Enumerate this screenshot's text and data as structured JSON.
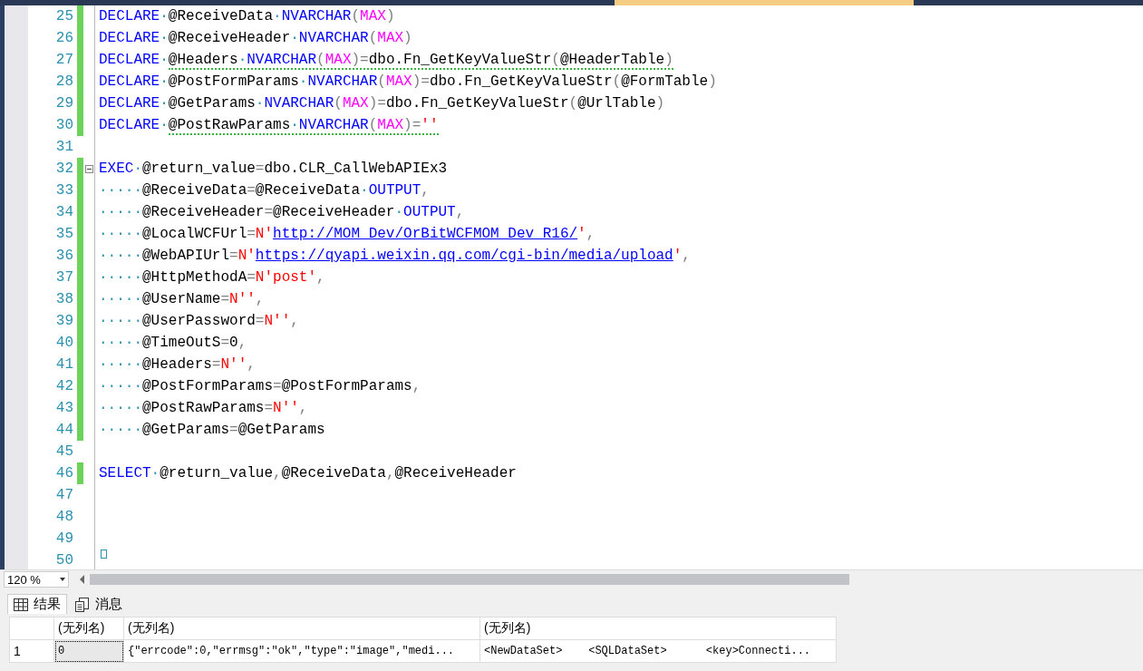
{
  "editor": {
    "lines": [
      {
        "number": "25",
        "changed": true,
        "collapsible": false,
        "segments": [
          {
            "squiggle": false,
            "tokens": [
              {
                "kind": "keyword",
                "text": "DECLARE"
              },
              {
                "kind": "ws",
                "text": "·"
              },
              {
                "kind": "plain",
                "text": "@ReceiveData"
              },
              {
                "kind": "ws",
                "text": "·"
              },
              {
                "kind": "keyword",
                "text": "NVARCHAR"
              },
              {
                "kind": "punct",
                "text": "("
              },
              {
                "kind": "function",
                "text": "MAX"
              },
              {
                "kind": "punct",
                "text": ")"
              }
            ]
          }
        ]
      },
      {
        "number": "26",
        "changed": true,
        "collapsible": false,
        "segments": [
          {
            "squiggle": false,
            "tokens": [
              {
                "kind": "keyword",
                "text": "DECLARE"
              },
              {
                "kind": "ws",
                "text": "·"
              },
              {
                "kind": "plain",
                "text": "@ReceiveHeader"
              },
              {
                "kind": "ws",
                "text": "·"
              },
              {
                "kind": "keyword",
                "text": "NVARCHAR"
              },
              {
                "kind": "punct",
                "text": "("
              },
              {
                "kind": "function",
                "text": "MAX"
              },
              {
                "kind": "punct",
                "text": ")"
              }
            ]
          }
        ]
      },
      {
        "number": "27",
        "changed": true,
        "collapsible": false,
        "segments": [
          {
            "squiggle": false,
            "tokens": [
              {
                "kind": "keyword",
                "text": "DECLARE"
              },
              {
                "kind": "ws",
                "text": "·"
              }
            ]
          },
          {
            "squiggle": true,
            "tokens": [
              {
                "kind": "plain",
                "text": "@Headers"
              },
              {
                "kind": "ws",
                "text": "·"
              },
              {
                "kind": "keyword",
                "text": "NVARCHAR"
              },
              {
                "kind": "punct",
                "text": "("
              },
              {
                "kind": "function",
                "text": "MAX"
              },
              {
                "kind": "punct",
                "text": ")="
              },
              {
                "kind": "plain",
                "text": "dbo.Fn_GetKeyValueStr"
              },
              {
                "kind": "punct",
                "text": "("
              },
              {
                "kind": "plain",
                "text": "@HeaderTable"
              },
              {
                "kind": "punct",
                "text": ")"
              }
            ]
          }
        ]
      },
      {
        "number": "28",
        "changed": true,
        "collapsible": false,
        "segments": [
          {
            "squiggle": false,
            "tokens": [
              {
                "kind": "keyword",
                "text": "DECLARE"
              },
              {
                "kind": "ws",
                "text": "·"
              },
              {
                "kind": "plain",
                "text": "@PostFormParams"
              },
              {
                "kind": "ws",
                "text": "·"
              },
              {
                "kind": "keyword",
                "text": "NVARCHAR"
              },
              {
                "kind": "punct",
                "text": "("
              },
              {
                "kind": "function",
                "text": "MAX"
              },
              {
                "kind": "punct",
                "text": ")="
              },
              {
                "kind": "plain",
                "text": "dbo.Fn_GetKeyValueStr"
              },
              {
                "kind": "punct",
                "text": "("
              },
              {
                "kind": "plain",
                "text": "@FormTable"
              },
              {
                "kind": "punct",
                "text": ")"
              }
            ]
          }
        ]
      },
      {
        "number": "29",
        "changed": true,
        "collapsible": false,
        "segments": [
          {
            "squiggle": false,
            "tokens": [
              {
                "kind": "keyword",
                "text": "DECLARE"
              },
              {
                "kind": "ws",
                "text": "·"
              },
              {
                "kind": "plain",
                "text": "@GetParams"
              },
              {
                "kind": "ws",
                "text": "·"
              },
              {
                "kind": "keyword",
                "text": "NVARCHAR"
              },
              {
                "kind": "punct",
                "text": "("
              },
              {
                "kind": "function",
                "text": "MAX"
              },
              {
                "kind": "punct",
                "text": ")="
              },
              {
                "kind": "plain",
                "text": "dbo.Fn_GetKeyValueStr"
              },
              {
                "kind": "punct",
                "text": "("
              },
              {
                "kind": "plain",
                "text": "@UrlTable"
              },
              {
                "kind": "punct",
                "text": ")"
              }
            ]
          }
        ]
      },
      {
        "number": "30",
        "changed": true,
        "collapsible": false,
        "segments": [
          {
            "squiggle": false,
            "tokens": [
              {
                "kind": "keyword",
                "text": "DECLARE"
              },
              {
                "kind": "ws",
                "text": "·"
              }
            ]
          },
          {
            "squiggle": true,
            "tokens": [
              {
                "kind": "plain",
                "text": "@PostRawParams"
              },
              {
                "kind": "ws",
                "text": "·"
              },
              {
                "kind": "keyword",
                "text": "NVARCHAR"
              },
              {
                "kind": "punct",
                "text": "("
              },
              {
                "kind": "function",
                "text": "MAX"
              },
              {
                "kind": "punct",
                "text": ")="
              },
              {
                "kind": "string",
                "text": "''"
              }
            ]
          }
        ]
      },
      {
        "number": "31",
        "changed": false,
        "collapsible": false
      },
      {
        "number": "32",
        "changed": true,
        "collapsible": true,
        "segments": [
          {
            "squiggle": false,
            "tokens": [
              {
                "kind": "keyword",
                "text": "EXEC"
              },
              {
                "kind": "ws",
                "text": "·"
              },
              {
                "kind": "plain",
                "text": "@return_value"
              },
              {
                "kind": "punct",
                "text": "="
              },
              {
                "kind": "plain",
                "text": "dbo.CLR_CallWebAPIEx3"
              }
            ]
          }
        ]
      },
      {
        "number": "33",
        "changed": true,
        "collapsible": false,
        "segments": [
          {
            "squiggle": false,
            "tokens": [
              {
                "kind": "ws",
                "text": "·····"
              },
              {
                "kind": "plain",
                "text": "@ReceiveData"
              },
              {
                "kind": "punct",
                "text": "="
              },
              {
                "kind": "plain",
                "text": "@ReceiveData"
              },
              {
                "kind": "ws",
                "text": "·"
              },
              {
                "kind": "keyword",
                "text": "OUTPUT"
              },
              {
                "kind": "punct",
                "text": ","
              }
            ]
          }
        ]
      },
      {
        "number": "34",
        "changed": true,
        "collapsible": false,
        "segments": [
          {
            "squiggle": false,
            "tokens": [
              {
                "kind": "ws",
                "text": "·····"
              },
              {
                "kind": "plain",
                "text": "@ReceiveHeader"
              },
              {
                "kind": "punct",
                "text": "="
              },
              {
                "kind": "plain",
                "text": "@ReceiveHeader"
              },
              {
                "kind": "ws",
                "text": "·"
              },
              {
                "kind": "keyword",
                "text": "OUTPUT"
              },
              {
                "kind": "punct",
                "text": ","
              }
            ]
          }
        ]
      },
      {
        "number": "35",
        "changed": true,
        "collapsible": false,
        "segments": [
          {
            "squiggle": false,
            "tokens": [
              {
                "kind": "ws",
                "text": "·····"
              },
              {
                "kind": "plain",
                "text": "@LocalWCFUrl"
              },
              {
                "kind": "punct",
                "text": "="
              },
              {
                "kind": "string",
                "text": "N'"
              },
              {
                "kind": "link",
                "text": "http://MOM_Dev/OrBitWCFMOM_Dev_R16/"
              },
              {
                "kind": "string",
                "text": "'"
              },
              {
                "kind": "punct",
                "text": ","
              }
            ]
          }
        ]
      },
      {
        "number": "36",
        "changed": true,
        "collapsible": false,
        "segments": [
          {
            "squiggle": false,
            "tokens": [
              {
                "kind": "ws",
                "text": "·····"
              },
              {
                "kind": "plain",
                "text": "@WebAPIUrl"
              },
              {
                "kind": "punct",
                "text": "="
              },
              {
                "kind": "string",
                "text": "N'"
              },
              {
                "kind": "link",
                "text": "https://qyapi.weixin.qq.com/cgi-bin/media/upload"
              },
              {
                "kind": "string",
                "text": "'"
              },
              {
                "kind": "punct",
                "text": ","
              }
            ]
          }
        ]
      },
      {
        "number": "37",
        "changed": true,
        "collapsible": false,
        "segments": [
          {
            "squiggle": false,
            "tokens": [
              {
                "kind": "ws",
                "text": "·····"
              },
              {
                "kind": "plain",
                "text": "@HttpMethodA"
              },
              {
                "kind": "punct",
                "text": "="
              },
              {
                "kind": "string",
                "text": "N'post'"
              },
              {
                "kind": "punct",
                "text": ","
              }
            ]
          }
        ]
      },
      {
        "number": "38",
        "changed": true,
        "collapsible": false,
        "segments": [
          {
            "squiggle": false,
            "tokens": [
              {
                "kind": "ws",
                "text": "·····"
              },
              {
                "kind": "plain",
                "text": "@UserName"
              },
              {
                "kind": "punct",
                "text": "="
              },
              {
                "kind": "string",
                "text": "N''"
              },
              {
                "kind": "punct",
                "text": ","
              }
            ]
          }
        ]
      },
      {
        "number": "39",
        "changed": true,
        "collapsible": false,
        "segments": [
          {
            "squiggle": false,
            "tokens": [
              {
                "kind": "ws",
                "text": "·····"
              },
              {
                "kind": "plain",
                "text": "@UserPassword"
              },
              {
                "kind": "punct",
                "text": "="
              },
              {
                "kind": "string",
                "text": "N''"
              },
              {
                "kind": "punct",
                "text": ","
              }
            ]
          }
        ]
      },
      {
        "number": "40",
        "changed": true,
        "collapsible": false,
        "segments": [
          {
            "squiggle": false,
            "tokens": [
              {
                "kind": "ws",
                "text": "·····"
              },
              {
                "kind": "plain",
                "text": "@TimeOutS"
              },
              {
                "kind": "punct",
                "text": "="
              },
              {
                "kind": "plain",
                "text": "0"
              },
              {
                "kind": "punct",
                "text": ","
              }
            ]
          }
        ]
      },
      {
        "number": "41",
        "changed": true,
        "collapsible": false,
        "segments": [
          {
            "squiggle": false,
            "tokens": [
              {
                "kind": "ws",
                "text": "·····"
              },
              {
                "kind": "plain",
                "text": "@Headers"
              },
              {
                "kind": "punct",
                "text": "="
              },
              {
                "kind": "string",
                "text": "N''"
              },
              {
                "kind": "punct",
                "text": ","
              }
            ]
          }
        ]
      },
      {
        "number": "42",
        "changed": true,
        "collapsible": false,
        "segments": [
          {
            "squiggle": false,
            "tokens": [
              {
                "kind": "ws",
                "text": "·····"
              },
              {
                "kind": "plain",
                "text": "@PostFormParams"
              },
              {
                "kind": "punct",
                "text": "="
              },
              {
                "kind": "plain",
                "text": "@PostFormParams"
              },
              {
                "kind": "punct",
                "text": ","
              }
            ]
          }
        ]
      },
      {
        "number": "43",
        "changed": true,
        "collapsible": false,
        "segments": [
          {
            "squiggle": false,
            "tokens": [
              {
                "kind": "ws",
                "text": "·····"
              },
              {
                "kind": "plain",
                "text": "@PostRawParams"
              },
              {
                "kind": "punct",
                "text": "="
              },
              {
                "kind": "string",
                "text": "N''"
              },
              {
                "kind": "punct",
                "text": ","
              }
            ]
          }
        ]
      },
      {
        "number": "44",
        "changed": true,
        "collapsible": false,
        "segments": [
          {
            "squiggle": false,
            "tokens": [
              {
                "kind": "ws",
                "text": "·····"
              },
              {
                "kind": "plain",
                "text": "@GetParams"
              },
              {
                "kind": "punct",
                "text": "="
              },
              {
                "kind": "plain",
                "text": "@GetParams"
              }
            ]
          }
        ]
      },
      {
        "number": "45",
        "changed": false,
        "collapsible": false
      },
      {
        "number": "46",
        "changed": true,
        "collapsible": false,
        "segments": [
          {
            "squiggle": false,
            "tokens": [
              {
                "kind": "keyword",
                "text": "SELECT"
              },
              {
                "kind": "ws",
                "text": "·"
              },
              {
                "kind": "plain",
                "text": "@return_value"
              },
              {
                "kind": "punct",
                "text": ","
              },
              {
                "kind": "plain",
                "text": "@ReceiveData"
              },
              {
                "kind": "punct",
                "text": ","
              },
              {
                "kind": "plain",
                "text": "@ReceiveHeader"
              }
            ]
          }
        ]
      },
      {
        "number": "47",
        "changed": false,
        "collapsible": false
      },
      {
        "number": "48",
        "changed": false,
        "collapsible": false
      },
      {
        "number": "49",
        "changed": false,
        "collapsible": false
      },
      {
        "number": "50",
        "changed": false,
        "collapsible": false
      }
    ]
  },
  "zoom": {
    "value": "120 %"
  },
  "result_tabs": [
    {
      "label": "结果",
      "kind": "grid",
      "selected": true
    },
    {
      "label": "消息",
      "kind": "messages",
      "selected": false
    }
  ],
  "results": {
    "columns": [
      "(无列名)",
      "(无列名)",
      "(无列名)"
    ],
    "rows": [
      {
        "number": "1",
        "cells": [
          {
            "text": "0",
            "selected": true
          },
          {
            "text": "{\"errcode\":0,\"errmsg\":\"ok\",\"type\":\"image\",\"medi...",
            "selected": false
          },
          {
            "text": "<NewDataSet>    <SQLDataSet>      <key>Connecti...",
            "selected": false
          }
        ]
      }
    ]
  }
}
